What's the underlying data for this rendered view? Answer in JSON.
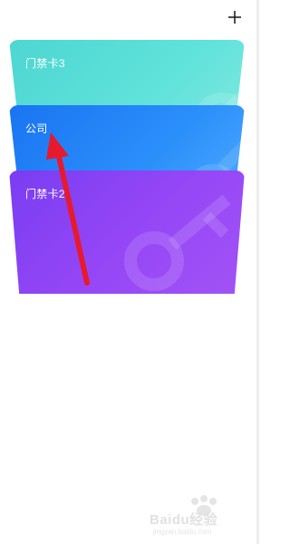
{
  "header": {
    "add_label": "+"
  },
  "cards": [
    {
      "label": "门禁卡3"
    },
    {
      "label": "公司"
    },
    {
      "label": "门禁卡2"
    }
  ],
  "watermark": {
    "brand": "Baidu经验",
    "url": "jingyan.baidu.com"
  },
  "colors": {
    "card1": "#4ed6d2",
    "card2": "#1a74f2",
    "card3": "#8a43f5",
    "annotation_arrow": "#e8192c"
  },
  "icons": {
    "add": "plus-icon",
    "card_decor": "key-icon"
  }
}
